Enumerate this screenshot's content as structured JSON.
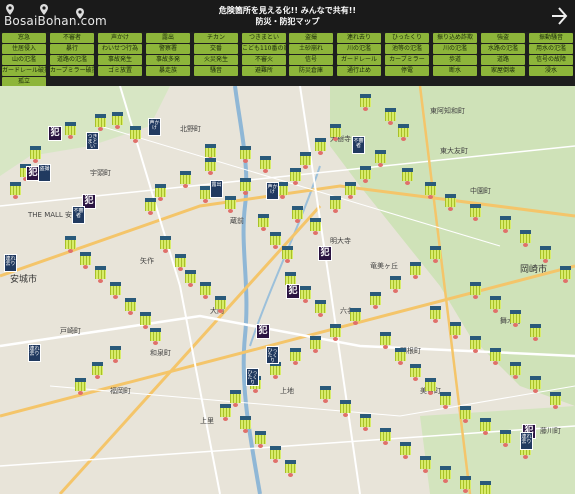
{
  "header": {
    "logo_text": "BosaiBohan.com",
    "headline_line1": "危険箇所を見える化!! みんなで共有!!",
    "headline_line2": "防災・防犯マップ"
  },
  "colors": {
    "filter_bg": "#8db53a",
    "header_bg": "#1a1a1a",
    "map_bg": "#e6e2d8"
  },
  "filters": [
    "窓急",
    "不審者",
    "声かけ",
    "露出",
    "チカン",
    "つきまとい",
    "盗撮",
    "連れ去り",
    "ひったくり",
    "振り込め詐欺",
    "強盗",
    "振動騒音",
    "住居侵入",
    "暴行",
    "わいせつ行為",
    "警察署",
    "交番",
    "こども110番の家",
    "土砂崩れ",
    "川の氾濫",
    "池等の氾濫",
    "川の氾濫",
    "水路の氾濫",
    "用水の氾濫",
    "山の氾濫",
    "道路の氾濫",
    "事故発生",
    "事故多発",
    "火災発生",
    "不審火",
    "信号",
    "ガードレール",
    "カーブミラー",
    "歩道",
    "道路",
    "信号の故障",
    "ガードレール破損",
    "カーブミラー破損",
    "ゴミ放置",
    "暴走族",
    "騒音",
    "避難所",
    "防災倉庫",
    "通行止め",
    "停電",
    "断水",
    "家屋倒壊",
    "浸水",
    "孤立"
  ],
  "map": {
    "places": [
      "安城市",
      "岡崎市",
      "THE MALL 安城",
      "北野町",
      "矢作",
      "大門",
      "上地",
      "東大友町",
      "中園町",
      "六名",
      "羽根町",
      "福岡町",
      "舞木町",
      "藤川町",
      "竜美ヶ丘",
      "明大寺",
      "上里",
      "戸崎町",
      "宇頭町",
      "和泉町",
      "美合町",
      "東阿知和町",
      "蔵前",
      "大樹寺"
    ],
    "crime_label": "犯",
    "tag_labels": [
      "つきまとい",
      "連れ去り",
      "声かけ",
      "盗撮",
      "ひったくり",
      "不審者",
      "露出"
    ]
  }
}
